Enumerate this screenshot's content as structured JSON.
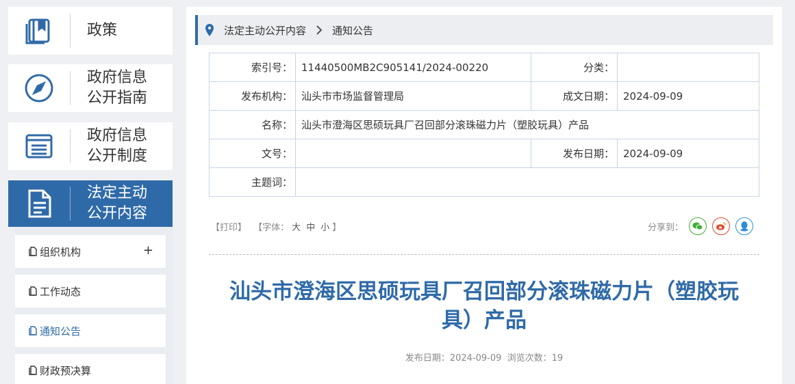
{
  "sidebar": {
    "menu": [
      {
        "label": "政策",
        "icon": "policy-book-icon"
      },
      {
        "label": "政府信息\n公开指南",
        "icon": "compass-icon"
      },
      {
        "label": "政府信息\n公开制度",
        "icon": "list-doc-icon"
      },
      {
        "label": "法定主动\n公开内容",
        "icon": "document-icon"
      }
    ],
    "sub_items": [
      {
        "label": "组织机构",
        "expand": "+"
      },
      {
        "label": "工作动态"
      },
      {
        "label": "通知公告"
      },
      {
        "label": "财政预决算"
      }
    ]
  },
  "breadcrumb": {
    "section": "法定主动公开内容",
    "current": "通知公告"
  },
  "info_table": {
    "index_label": "索引号：",
    "index_value": "11440500MB2C905141/2024-00220",
    "category_label": "分类：",
    "category_value": "",
    "publisher_label": "发布机构：",
    "publisher_value": "汕头市市场监督管理局",
    "written_date_label": "成文日期：",
    "written_date_value": "2024-09-09",
    "name_label": "名称：",
    "name_value": "汕头市澄海区思硕玩具厂召回部分滚珠磁力片（塑胶玩具）产品",
    "doc_no_label": "文号：",
    "doc_no_value": "",
    "publish_date_label": "发布日期：",
    "publish_date_value": "2024-09-09",
    "keywords_label": "主题词：",
    "keywords_value": ""
  },
  "tools": {
    "print": "【打印】",
    "font_prefix": "【字体：",
    "font_large": "大",
    "font_medium": "中",
    "font_small": "小",
    "font_suffix": "】"
  },
  "share": {
    "label": "分享到：",
    "colors": {
      "wechat": "#3cb034",
      "weibo": "#e6462c",
      "qq": "#2c8fd8"
    }
  },
  "article": {
    "title": "汕头市澄海区思硕玩具厂召回部分滚珠磁力片（塑胶玩具）产品",
    "meta": "发布日期：2024-09-09  浏览次数：19"
  },
  "colors": {
    "accent": "#2f6aa8"
  }
}
